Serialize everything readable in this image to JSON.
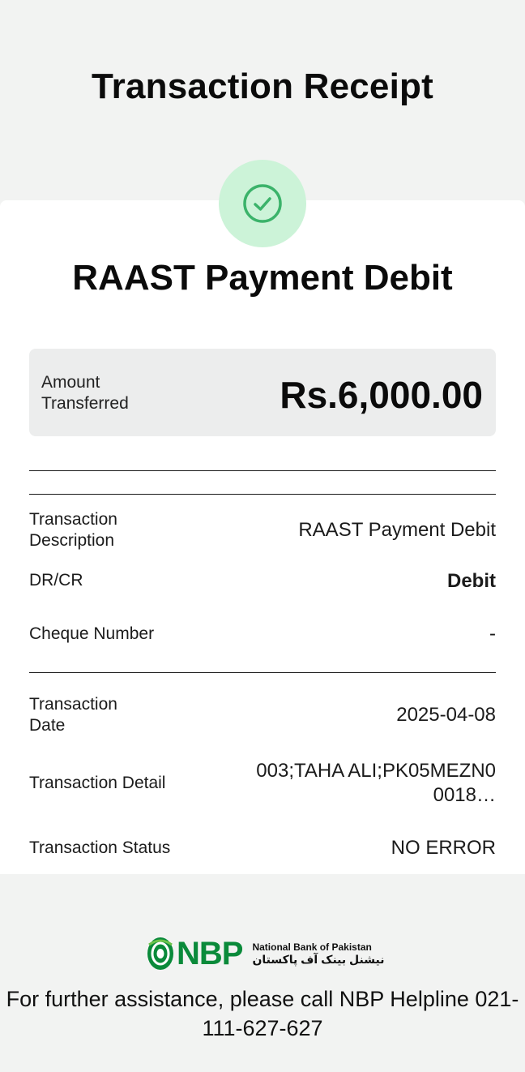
{
  "header": {
    "title": "Transaction Receipt"
  },
  "status_icon": "check-circle-icon",
  "transaction": {
    "type": "RAAST Payment Debit"
  },
  "amount": {
    "label": "Amount Transferred",
    "value": "Rs.6,000.00"
  },
  "details": {
    "description_label": "Transaction Description",
    "description_value": "RAAST Payment Debit",
    "drcr_label": "DR/CR",
    "drcr_value": "Debit",
    "cheque_label": "Cheque Number",
    "cheque_value": "-",
    "date_label": "Transaction Date",
    "date_value": "2025-04-08",
    "detail_label": "Transaction Detail",
    "detail_value": "003;TAHA ALI;PK05MEZN00018…",
    "status_label": "Transaction Status",
    "status_value": "NO ERROR"
  },
  "footer": {
    "logo_text": "NBP",
    "bank_name_en": "National Bank of Pakistan",
    "bank_name_ur": "نیشنل بینک آف پاکستان",
    "helpline": "For further assistance, please call NBP Helpline 021-111-627-627"
  },
  "colors": {
    "success_bg": "#ccf3d8",
    "success_fg": "#3bb36a",
    "brand_green": "#0a8a3a"
  }
}
